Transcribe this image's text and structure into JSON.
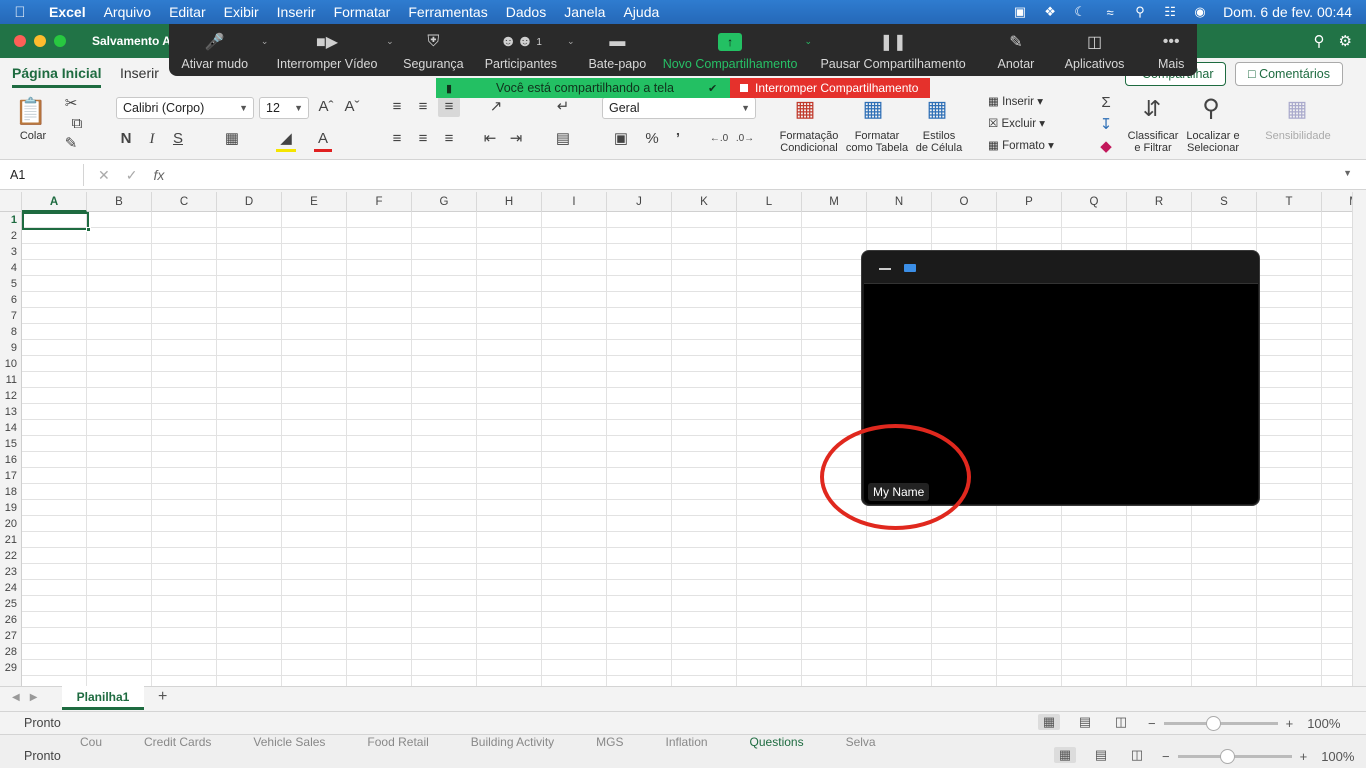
{
  "menubar": {
    "app": "Excel",
    "items": [
      "Arquivo",
      "Editar",
      "Exibir",
      "Inserir",
      "Formatar",
      "Ferramentas",
      "Dados",
      "Janela",
      "Ajuda"
    ],
    "clock": "Dom. 6 de fev.  00:44"
  },
  "titlebar": {
    "autosave": "Salvamento Au"
  },
  "zoom_toolbar": {
    "mute": "Ativar mudo",
    "video": "Interromper Vídeo",
    "security": "Segurança",
    "participants": "Participantes",
    "participants_count": "1",
    "chat": "Bate-papo",
    "new_share": "Novo Compartilhamento",
    "pause_share": "Pausar Compartilhamento",
    "annotate": "Anotar",
    "apps": "Aplicativos",
    "more": "Mais"
  },
  "share_banner": {
    "sharing_text": "Você está compartilhando a tela",
    "stop_text": "Interromper Compartilhamento"
  },
  "ribbon_tabs": {
    "home": "Página Inicial",
    "insert": "Inserir",
    "share_button": "Compartilhar",
    "comments_button": "Comentários"
  },
  "ribbon": {
    "paste": "Colar",
    "font_name": "Calibri (Corpo)",
    "font_size": "12",
    "number_format": "Geral",
    "conditional": [
      "Formatação",
      "Condicional"
    ],
    "format_table": [
      "Formatar",
      "como Tabela"
    ],
    "cell_styles": [
      "Estilos",
      "de Célula"
    ],
    "insert_cells": "Inserir",
    "delete_cells": "Excluir",
    "format_cells": "Formato",
    "sort_filter": [
      "Classificar",
      "e Filtrar"
    ],
    "find_select": [
      "Localizar e",
      "Selecionar"
    ],
    "sensitivity": "Sensibilidade"
  },
  "formula_bar": {
    "name_box": "A1",
    "fx": "fx",
    "content": ""
  },
  "grid": {
    "columns": [
      "A",
      "B",
      "C",
      "D",
      "E",
      "F",
      "G",
      "H",
      "I",
      "J",
      "K",
      "L",
      "M",
      "N",
      "O",
      "P",
      "Q",
      "R",
      "S",
      "T",
      "M"
    ],
    "rows": [
      "1",
      "2",
      "3",
      "4",
      "5",
      "6",
      "7",
      "8",
      "9",
      "10",
      "11",
      "12",
      "13",
      "14",
      "15",
      "16",
      "17",
      "18",
      "19",
      "20",
      "21",
      "22",
      "23",
      "24",
      "25",
      "26",
      "27",
      "28",
      "29"
    ],
    "selected_cell": "A1"
  },
  "sheets": {
    "active": "Planilha1"
  },
  "status": {
    "ready": "Pronto",
    "zoom": "100%",
    "ghost_tabs": [
      "Cou",
      "Credit Cards",
      "Vehicle Sales",
      "Food Retail",
      "Building Activity",
      "MGS",
      "Inflation",
      "Questions",
      "Selva"
    ]
  },
  "self_view": {
    "name": "My Name"
  },
  "colors": {
    "excel_green": "#217346",
    "zoom_green": "#23c063",
    "stop_red": "#e5312c",
    "annotation_red": "#e0281e"
  }
}
